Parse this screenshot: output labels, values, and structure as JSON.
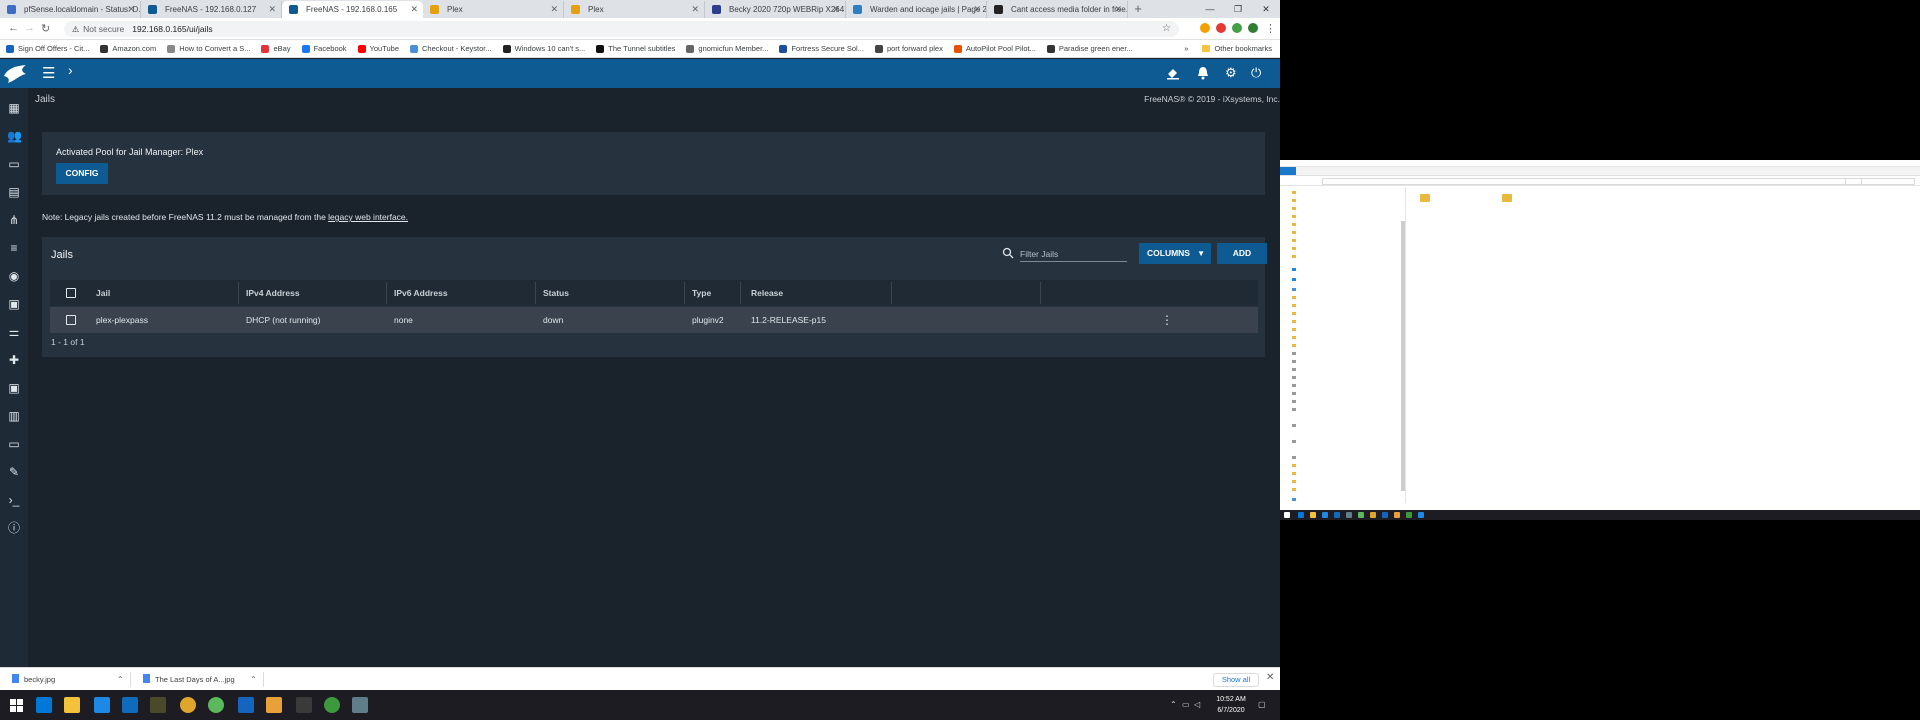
{
  "browser": {
    "tabs": [
      {
        "label": "pfSense.localdomain - Status: D...",
        "color": "#3f6dc4"
      },
      {
        "label": "FreeNAS - 192.168.0.127",
        "color": "#0e5a92"
      },
      {
        "label": "FreeNAS - 192.168.0.165",
        "color": "#0e5a92",
        "active": true
      },
      {
        "label": "Plex",
        "color": "#e5a00d"
      },
      {
        "label": "Plex",
        "color": "#e5a00d"
      },
      {
        "label": "Becky 2020 720p WEBRip X264 ...",
        "color": "#2c3e8c"
      },
      {
        "label": "Warden and iocage jails | Page 2...",
        "color": "#2d7fc2"
      },
      {
        "label": "Cant access media folder in free...",
        "color": "#222222"
      }
    ],
    "new_tab": "+",
    "url_not_secure": "Not secure",
    "url": "192.168.0.165/ui/jails",
    "bookmarks": [
      {
        "label": "Sign Off Offers - Cit...",
        "color": "#1565c0"
      },
      {
        "label": "Amazon.com",
        "color": "#333333"
      },
      {
        "label": "How to Convert a S...",
        "color": "#888888"
      },
      {
        "label": "eBay",
        "color": "#e53238"
      },
      {
        "label": "Facebook",
        "color": "#1877f2"
      },
      {
        "label": "YouTube",
        "color": "#ff0000"
      },
      {
        "label": "Checkout - Keystor...",
        "color": "#4a90d9"
      },
      {
        "label": "Windows 10 can't s...",
        "color": "#222222"
      },
      {
        "label": "The Tunnel subtitles",
        "color": "#111111"
      },
      {
        "label": "gnomicfun Member...",
        "color": "#666666"
      },
      {
        "label": "Fortress Secure Sol...",
        "color": "#1a4f9c"
      },
      {
        "label": "port forward plex",
        "color": "#444444"
      },
      {
        "label": "AutoPilot Pool Pilot...",
        "color": "#e65100"
      },
      {
        "label": "Paradise green ener...",
        "color": "#333333"
      }
    ],
    "other_bookmarks": "Other bookmarks"
  },
  "app": {
    "page_heading": "Jails",
    "copyright": "FreeNAS® © 2019 - iXsystems, Inc.",
    "pool_card": {
      "title": "Activated Pool for Jail Manager: Plex",
      "config_label": "CONFIG"
    },
    "legacy_note": {
      "prefix": "Note: Legacy jails created before FreeNAS 11.2 must be managed from the ",
      "link": "legacy web interface."
    },
    "jails_card": {
      "title": "Jails",
      "filter_placeholder": "Filter Jails",
      "columns_label": "COLUMNS",
      "add_label": "ADD",
      "headers": [
        "Jail",
        "IPv4 Address",
        "IPv6 Address",
        "Status",
        "Type",
        "Release"
      ],
      "rows": [
        {
          "jail": "plex-plexpass",
          "ipv4": "DHCP (not running)",
          "ipv6": "none",
          "status": "down",
          "type": "pluginv2",
          "release": "11.2-RELEASE-p15"
        }
      ],
      "pager": "1 - 1 of 1"
    }
  },
  "downloads": {
    "items": [
      "becky.jpg",
      "The Last Days of A...jpg"
    ],
    "show_all": "Show all"
  },
  "taskbar": {
    "time": "10:52 AM",
    "date": "6/7/2020"
  }
}
